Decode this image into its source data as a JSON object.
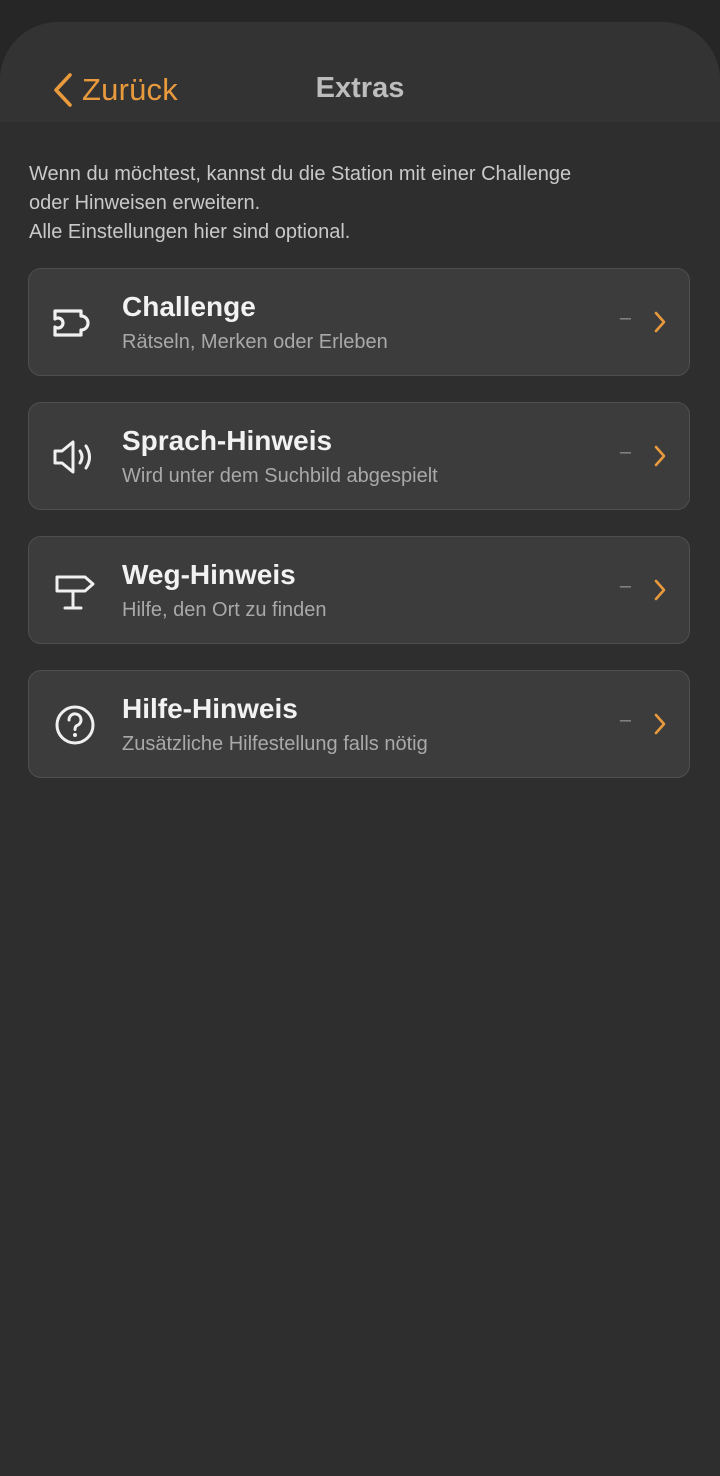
{
  "nav": {
    "back_label": "Zurück",
    "title": "Extras"
  },
  "intro": {
    "line1": "Wenn du möchtest, kannst du die Station mit einer Challenge",
    "line2": "oder Hinweisen erweitern.",
    "line3": "Alle Einstellungen hier sind optional."
  },
  "items": [
    {
      "icon": "puzzle-icon",
      "title": "Challenge",
      "subtitle": "Rätseln, Merken oder Erleben",
      "value": "–"
    },
    {
      "icon": "speaker-icon",
      "title": "Sprach-Hinweis",
      "subtitle": "Wird unter dem Suchbild abgespielt",
      "value": "–"
    },
    {
      "icon": "signpost-icon",
      "title": "Weg-Hinweis",
      "subtitle": "Hilfe, den Ort zu finden",
      "value": "–"
    },
    {
      "icon": "question-circle-icon",
      "title": "Hilfe-Hinweis",
      "subtitle": "Zusätzliche Hilfestellung falls nötig",
      "value": "–"
    }
  ],
  "colors": {
    "accent": "#e89a3c",
    "background": "#2e2e2e",
    "card": "#3c3c3c"
  }
}
